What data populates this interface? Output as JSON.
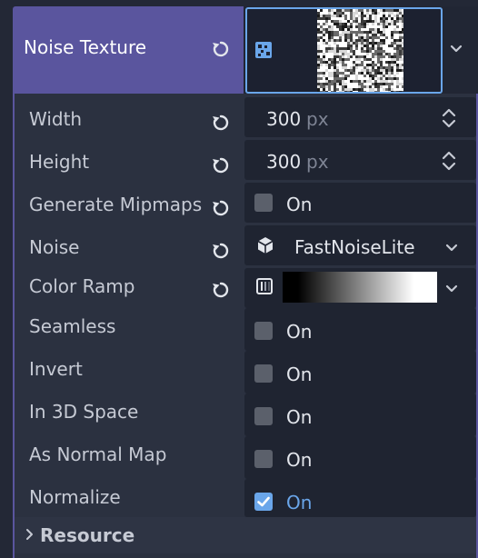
{
  "header": {
    "title": "Noise Texture",
    "icons": {
      "revert": "revert-icon",
      "resource": "noise-texture-icon",
      "menu": "chevron-down-icon"
    }
  },
  "properties": {
    "width": {
      "label": "Width",
      "value": "300",
      "unit": "px"
    },
    "height": {
      "label": "Height",
      "value": "300",
      "unit": "px"
    },
    "generate_mipmaps": {
      "label": "Generate Mipmaps",
      "value_label": "On",
      "checked": false
    },
    "noise": {
      "label": "Noise",
      "resource": "FastNoiseLite"
    },
    "color_ramp": {
      "label": "Color Ramp"
    },
    "seamless": {
      "label": "Seamless",
      "value_label": "On",
      "checked": false
    },
    "invert": {
      "label": "Invert",
      "value_label": "On",
      "checked": false
    },
    "in_3d_space": {
      "label": "In 3D Space",
      "value_label": "On",
      "checked": false
    },
    "as_normal_map": {
      "label": "As Normal Map",
      "value_label": "On",
      "checked": false
    },
    "normalize": {
      "label": "Normalize",
      "value_label": "On",
      "checked": true
    }
  },
  "footer": {
    "title": "Resource"
  },
  "colors": {
    "accent": "#6aa6ea",
    "header_bg": "#5a559e",
    "panel_bg": "#2b3140",
    "field_bg": "#1f2431"
  }
}
